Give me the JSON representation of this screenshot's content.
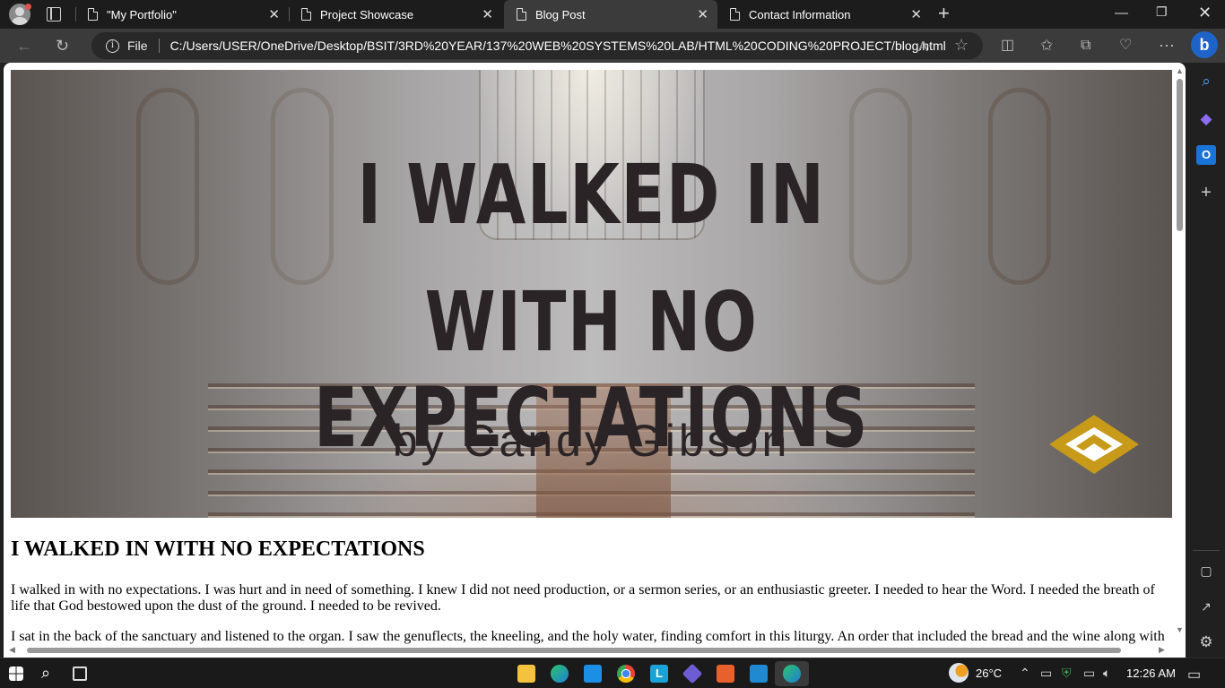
{
  "browser": {
    "tabs": [
      {
        "title": "\"My Portfolio\"",
        "active": false
      },
      {
        "title": "Project Showcase",
        "active": false
      },
      {
        "title": "Blog Post",
        "active": true
      },
      {
        "title": "Contact Information",
        "active": false
      }
    ],
    "address": {
      "scheme_label": "File",
      "url": "C:/Users/USER/OneDrive/Desktop/BSIT/3RD%20YEAR/137%20WEB%20SYSTEMS%20LAB/HTML%20CODING%20PROJECT/blog.html"
    }
  },
  "hero": {
    "line1": "I WALKED IN",
    "line2": "WITH NO EXPECTATIONS",
    "byline": "by Candy Gibson",
    "logo_color": "#c89a1a"
  },
  "post": {
    "title": "I WALKED IN WITH NO EXPECTATIONS",
    "paragraphs": [
      "I walked in with no expectations. I was hurt and in need of something. I knew I did not need production, or a sermon series, or an enthusiastic greeter. I needed to hear the Word. I needed the breath of life that God bestowed upon the dust of the ground. I needed to be revived.",
      "I sat in the back of the sanctuary and listened to the organ. I saw the genuflects, the kneeling, and the holy water, finding comfort in this liturgy. An order that included the bread and the wine along with"
    ]
  },
  "taskbar": {
    "weather": "26°C",
    "time": "12:26 AM"
  }
}
